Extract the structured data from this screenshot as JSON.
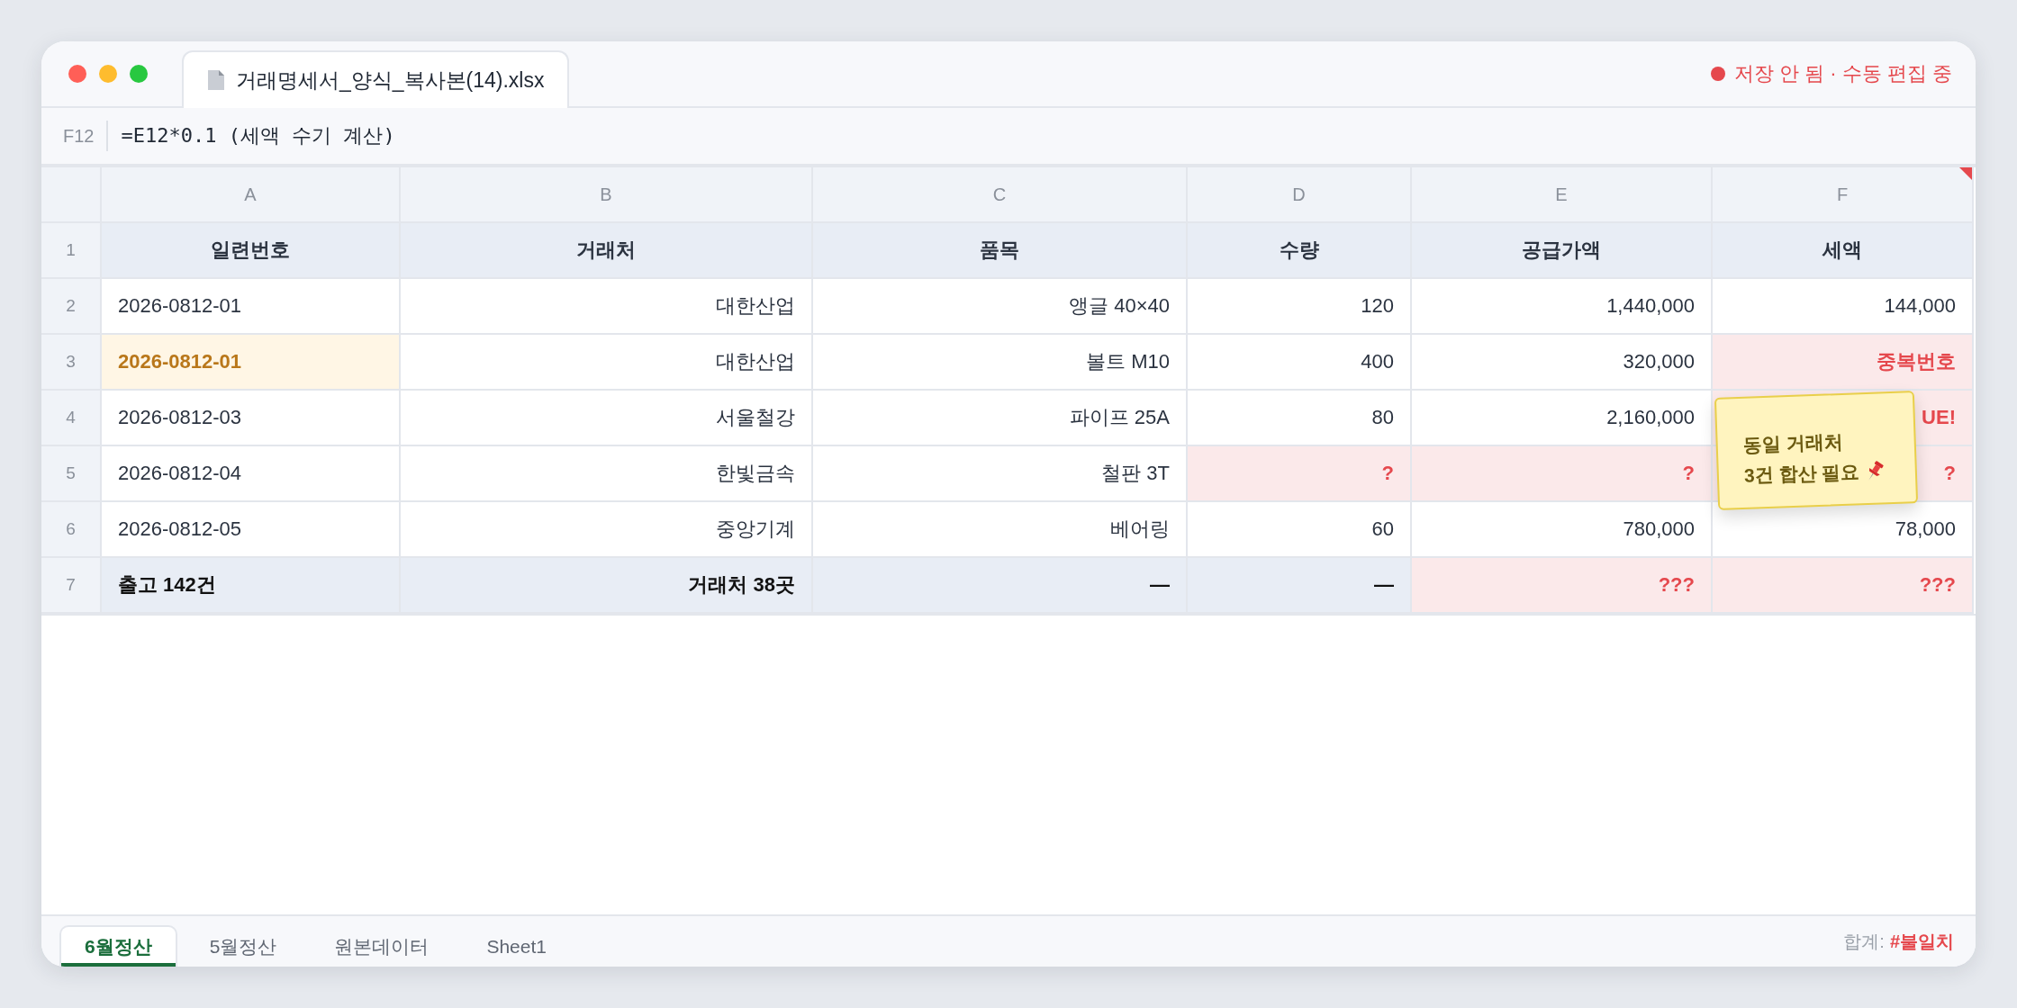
{
  "window": {
    "file_tab": "거래명세서_양식_복사본(14).xlsx",
    "status": "저장 안 됨 · 수동 편집 중"
  },
  "formula_bar": {
    "cell_ref": "F12",
    "formula": "=E12*0.1 (세액 수기 계산)"
  },
  "columns": [
    {
      "letter": "A",
      "flagged": false
    },
    {
      "letter": "B",
      "flagged": false
    },
    {
      "letter": "C",
      "flagged": false
    },
    {
      "letter": "D",
      "flagged": false
    },
    {
      "letter": "E",
      "flagged": false
    },
    {
      "letter": "F",
      "flagged": true
    }
  ],
  "rows": [
    {
      "num": "1",
      "kind": "header",
      "cells": [
        {
          "text": "일련번호"
        },
        {
          "text": "거래처"
        },
        {
          "text": "품목"
        },
        {
          "text": "수량"
        },
        {
          "text": "공급가액"
        },
        {
          "text": "세액"
        }
      ]
    },
    {
      "num": "2",
      "kind": "data",
      "cells": [
        {
          "text": "2026-0812-01",
          "kind": "plain"
        },
        {
          "text": "대한산업",
          "kind": "plain"
        },
        {
          "text": "앵글 40×40",
          "kind": "plain"
        },
        {
          "text": "120",
          "kind": "plain"
        },
        {
          "text": "1,440,000",
          "kind": "plain"
        },
        {
          "text": "144,000",
          "kind": "plain"
        }
      ]
    },
    {
      "num": "3",
      "kind": "data",
      "cells": [
        {
          "text": "2026-0812-01",
          "kind": "warning"
        },
        {
          "text": "대한산업",
          "kind": "plain"
        },
        {
          "text": "볼트 M10",
          "kind": "plain"
        },
        {
          "text": "400",
          "kind": "plain"
        },
        {
          "text": "320,000",
          "kind": "plain"
        },
        {
          "text": "중복번호",
          "kind": "error"
        }
      ]
    },
    {
      "num": "4",
      "kind": "data",
      "cells": [
        {
          "text": "2026-0812-03",
          "kind": "plain"
        },
        {
          "text": "서울철강",
          "kind": "plain"
        },
        {
          "text": "파이프 25A",
          "kind": "plain"
        },
        {
          "text": "80",
          "kind": "plain"
        },
        {
          "text": "2,160,000",
          "kind": "plain"
        },
        {
          "text": "UE!",
          "kind": "error"
        }
      ]
    },
    {
      "num": "5",
      "kind": "data",
      "cells": [
        {
          "text": "2026-0812-04",
          "kind": "plain"
        },
        {
          "text": "한빛금속",
          "kind": "plain"
        },
        {
          "text": "철판 3T",
          "kind": "plain"
        },
        {
          "text": "?",
          "kind": "error"
        },
        {
          "text": "?",
          "kind": "error"
        },
        {
          "text": "?",
          "kind": "error"
        }
      ]
    },
    {
      "num": "6",
      "kind": "data",
      "cells": [
        {
          "text": "2026-0812-05",
          "kind": "plain"
        },
        {
          "text": "중앙기계",
          "kind": "plain"
        },
        {
          "text": "베어링",
          "kind": "plain"
        },
        {
          "text": "60",
          "kind": "plain"
        },
        {
          "text": "780,000",
          "kind": "plain"
        },
        {
          "text": "78,000",
          "kind": "plain"
        }
      ]
    },
    {
      "num": "7",
      "kind": "total",
      "cells": [
        {
          "text": "출고 142건",
          "kind": "plain"
        },
        {
          "text": "거래처 38곳",
          "kind": "plain"
        },
        {
          "text": "—",
          "kind": "plain"
        },
        {
          "text": "—",
          "kind": "plain"
        },
        {
          "text": "???",
          "kind": "error"
        },
        {
          "text": "???",
          "kind": "error"
        }
      ]
    }
  ],
  "sticky_note": {
    "text": "동일 거래처\n3건 합산 필요"
  },
  "sheet_tabs": [
    {
      "label": "6월정산",
      "selected": true
    },
    {
      "label": "5월정산",
      "selected": false
    },
    {
      "label": "원본데이터",
      "selected": false
    },
    {
      "label": "Sheet1",
      "selected": false
    }
  ],
  "footer": {
    "label": "합계:",
    "value": "#불일치"
  }
}
